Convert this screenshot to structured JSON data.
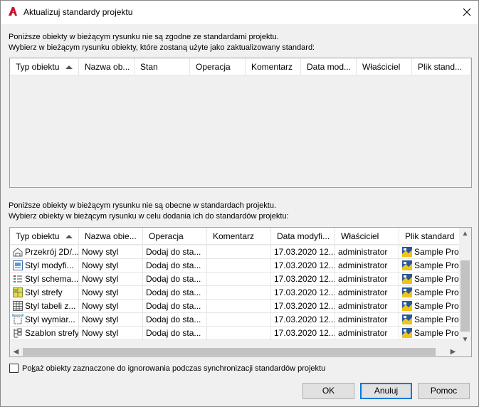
{
  "window": {
    "title": "Aktualizuj standardy projektu",
    "close_glyph": "✕"
  },
  "top_section": {
    "line1": "Poniższe obiekty w bieżącym rysunku nie są zgodne ze standardami projektu.",
    "line2": "Wybierz w bieżącym rysunku obiekty, które zostaną użyte jako zaktualizowany standard:",
    "columns": [
      "Typ obiektu",
      "Nazwa ob...",
      "Stan",
      "Operacja",
      "Komentarz",
      "Data mod...",
      "Właściciel",
      "Plik stand..."
    ],
    "rows": []
  },
  "bottom_section": {
    "line1": "Poniższe obiekty w bieżącym rysunku nie są obecne w standardach projektu.",
    "line2": "Wybierz obiekty w bieżącym rysunku w celu dodania ich do standardów projektu:",
    "columns": [
      "Typ obiektu",
      "Nazwa obie...",
      "Operacja",
      "Komentarz",
      "Data modyfi...",
      "Właściciel",
      "Plik standard"
    ],
    "rows": [
      {
        "icon": "section-style-icon",
        "type": "Przekrój 2D/...",
        "name": "Nowy styl",
        "operation": "Dodaj do sta...",
        "comment": "",
        "date": "17.03.2020 12...",
        "owner": "administrator",
        "file": "Sample Pro"
      },
      {
        "icon": "modifier-style-icon",
        "type": "Styl modyfi...",
        "name": "Nowy styl",
        "operation": "Dodaj do sta...",
        "comment": "",
        "date": "17.03.2020 12...",
        "owner": "administrator",
        "file": "Sample Pro"
      },
      {
        "icon": "schedule-style-icon",
        "type": "Styl schema...",
        "name": "Nowy styl",
        "operation": "Dodaj do sta...",
        "comment": "",
        "date": "17.03.2020 12...",
        "owner": "administrator",
        "file": "Sample Pro"
      },
      {
        "icon": "zone-style-icon",
        "type": "Styl strefy",
        "name": "Nowy styl",
        "operation": "Dodaj do sta...",
        "comment": "",
        "date": "17.03.2020 12...",
        "owner": "administrator",
        "file": "Sample Pro"
      },
      {
        "icon": "table-style-icon",
        "type": "Styl tabeli z...",
        "name": "Nowy styl",
        "operation": "Dodaj do sta...",
        "comment": "",
        "date": "17.03.2020 12...",
        "owner": "administrator",
        "file": "Sample Pro"
      },
      {
        "icon": "dimension-style-icon",
        "type": "Styl wymiar...",
        "name": "Nowy styl",
        "operation": "Dodaj do sta...",
        "comment": "",
        "date": "17.03.2020 12...",
        "owner": "administrator",
        "file": "Sample Pro"
      },
      {
        "icon": "zone-template-icon",
        "type": "Szablon strefy",
        "name": "Nowy styl",
        "operation": "Dodaj do sta...",
        "comment": "",
        "date": "17.03.2020 12...",
        "owner": "administrator",
        "file": "Sample Pro"
      }
    ]
  },
  "checkbox": {
    "label_underlined": "k",
    "label_before": "Po",
    "label_after": "aż obiekty zaznaczone do ignorowania podczas synchronizacji standardów projektu",
    "checked": false
  },
  "buttons": {
    "ok": "OK",
    "cancel": "Anuluj",
    "help": "Pomoc"
  },
  "colors": {
    "accent": "#0078d7",
    "app_icon": "#c8102e"
  }
}
